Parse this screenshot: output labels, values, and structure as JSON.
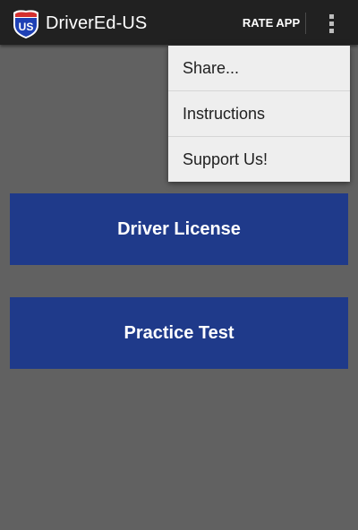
{
  "app": {
    "title": "DriverEd-US",
    "logo_label": "US"
  },
  "toolbar": {
    "rate_app_label": "RATE APP",
    "overflow_icon": "more-vert-icon"
  },
  "menu": {
    "items": [
      {
        "label": "Share..."
      },
      {
        "label": "Instructions"
      },
      {
        "label": "Support Us!"
      }
    ]
  },
  "main": {
    "buttons": [
      {
        "label": "Driver License"
      },
      {
        "label": "Practice Test"
      }
    ]
  },
  "colors": {
    "app_bar": "#212121",
    "background": "#616161",
    "button": "#1f3a8a",
    "menu": "#eeeeee",
    "logo_shield_blue": "#1e40b5",
    "logo_shield_red": "#d32f2f"
  }
}
